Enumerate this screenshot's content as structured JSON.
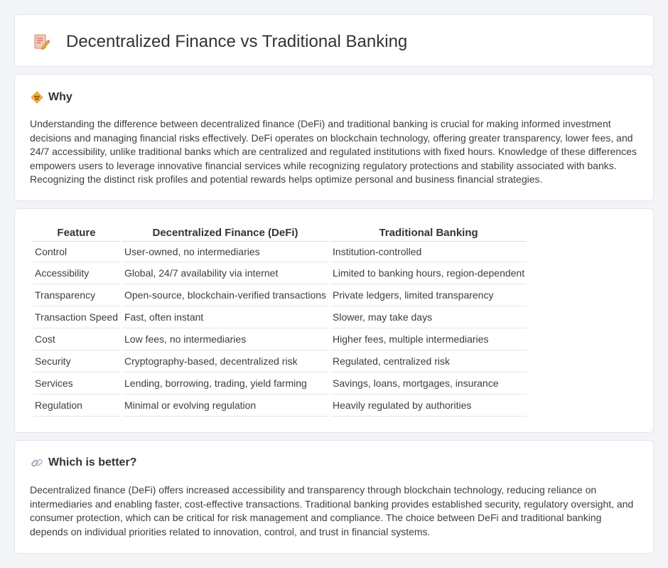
{
  "header": {
    "title": "Decentralized Finance vs Traditional Banking",
    "icon": "document-pencil-icon"
  },
  "why": {
    "title": "Why",
    "icon": "lightbulb-diamond-icon",
    "text": "Understanding the difference between decentralized finance (DeFi) and traditional banking is crucial for making informed investment decisions and managing financial risks effectively. DeFi operates on blockchain technology, offering greater transparency, lower fees, and 24/7 accessibility, unlike traditional banks which are centralized and regulated institutions with fixed hours. Knowledge of these differences empowers users to leverage innovative financial services while recognizing regulatory protections and stability associated with banks. Recognizing the distinct risk profiles and potential rewards helps optimize personal and business financial strategies."
  },
  "table": {
    "headers": [
      "Feature",
      "Decentralized Finance (DeFi)",
      "Traditional Banking"
    ],
    "rows": [
      [
        "Control",
        "User-owned, no intermediaries",
        "Institution-controlled"
      ],
      [
        "Accessibility",
        "Global, 24/7 availability via internet",
        "Limited to banking hours, region-dependent"
      ],
      [
        "Transparency",
        "Open-source, blockchain-verified transactions",
        "Private ledgers, limited transparency"
      ],
      [
        "Transaction Speed",
        "Fast, often instant",
        "Slower, may take days"
      ],
      [
        "Cost",
        "Low fees, no intermediaries",
        "Higher fees, multiple intermediaries"
      ],
      [
        "Security",
        "Cryptography-based, decentralized risk",
        "Regulated, centralized risk"
      ],
      [
        "Services",
        "Lending, borrowing, trading, yield farming",
        "Savings, loans, mortgages, insurance"
      ],
      [
        "Regulation",
        "Minimal or evolving regulation",
        "Heavily regulated by authorities"
      ]
    ]
  },
  "better": {
    "title": "Which is better?",
    "icon": "link-icon",
    "text": "Decentralized finance (DeFi) offers increased accessibility and transparency through blockchain technology, reducing reliance on intermediaries and enabling faster, cost-effective transactions. Traditional banking provides established security, regulatory oversight, and consumer protection, which can be critical for risk management and compliance. The choice between DeFi and traditional banking depends on individual priorities related to innovation, control, and trust in financial systems."
  }
}
